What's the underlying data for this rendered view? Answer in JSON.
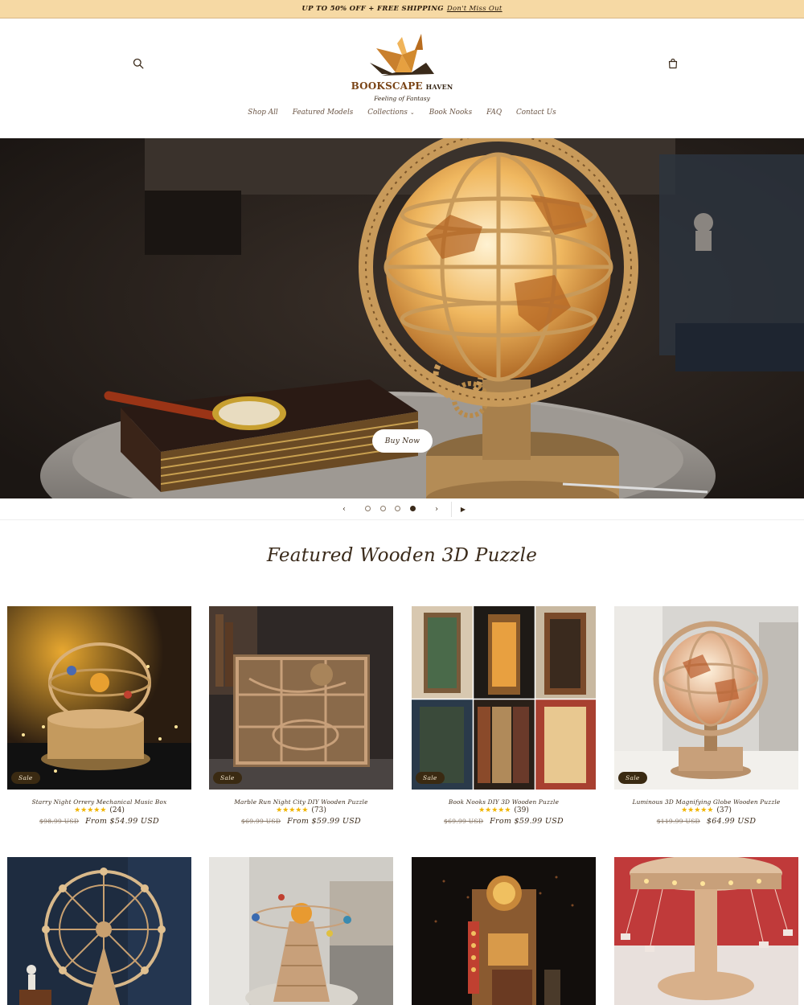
{
  "announcement": {
    "promo": "UP TO 50% OFF + FREE SHIPPING",
    "link": "Don't Miss Out"
  },
  "header": {
    "icons": {
      "search": "search-icon",
      "cart": "cart-icon"
    },
    "logo": {
      "name_line1": "BOOKSCAPE",
      "name_line2": "HAVEN",
      "tagline": "Feeling of Fantasy"
    }
  },
  "nav": {
    "items": [
      {
        "label": "Shop All"
      },
      {
        "label": "Featured Models"
      },
      {
        "label": "Collections",
        "dropdown": true
      },
      {
        "label": "Book Nooks"
      },
      {
        "label": "FAQ"
      },
      {
        "label": "Contact Us"
      }
    ]
  },
  "hero": {
    "button": "Buy Now"
  },
  "slider": {
    "prev": "‹",
    "next": "›",
    "play": "▶",
    "slides": 4,
    "active": 4
  },
  "featured": {
    "title": "Featured Wooden 3D Puzzle",
    "products": [
      {
        "title": "Starry Night Orrery Mechanical Music Box",
        "rating_count": "(24)",
        "old_price": "$98.99 USD",
        "price": "From $54.99 USD",
        "badge": "Sale",
        "stars": "★★★★★"
      },
      {
        "title": "Marble Run Night City DIY Wooden Puzzle",
        "rating_count": "(73)",
        "old_price": "$69.99 USD",
        "price": "From $59.99 USD",
        "badge": "Sale",
        "stars": "★★★★★"
      },
      {
        "title": "Book Nooks DIY 3D Wooden Puzzle",
        "rating_count": "(39)",
        "old_price": "$69.99 USD",
        "price": "From $59.99 USD",
        "badge": "Sale",
        "stars": "★★★★★"
      },
      {
        "title": "Luminous 3D Magnifying Globe Wooden Puzzle",
        "rating_count": "(37)",
        "old_price": "$119.99 USD",
        "price": "$64.99 USD",
        "badge": "Sale",
        "stars": "★★★★★"
      }
    ]
  },
  "colors": {
    "announcement_bg": "#f6d9a4",
    "brand": "#7a4416",
    "text": "#3a2a1a",
    "star": "#f0b400"
  }
}
